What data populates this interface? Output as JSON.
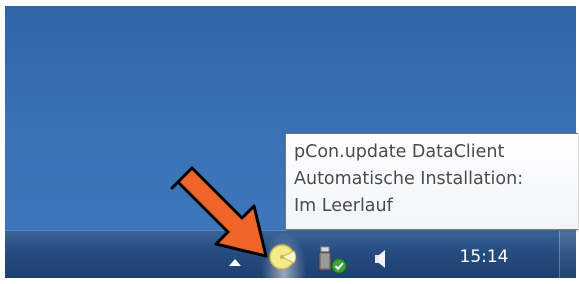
{
  "tooltip": {
    "lines": [
      "pCon.update DataClient",
      "Automatische Installation:",
      "Im Leerlauf"
    ]
  },
  "taskbar": {
    "clock": "15:14"
  },
  "icons": {
    "show_hidden": "chevron-up-icon",
    "pcon": "pcon-update-icon",
    "usb": "usb-safely-remove-icon",
    "volume": "speaker-icon",
    "annotation": "arrow-pointer-icon"
  },
  "colors": {
    "desktop": "#3a72b6",
    "taskbar": "#264c80",
    "arrow": "#f0642a",
    "check_badge": "#3aa23a",
    "pcon_icon": "#f3ea8c"
  }
}
